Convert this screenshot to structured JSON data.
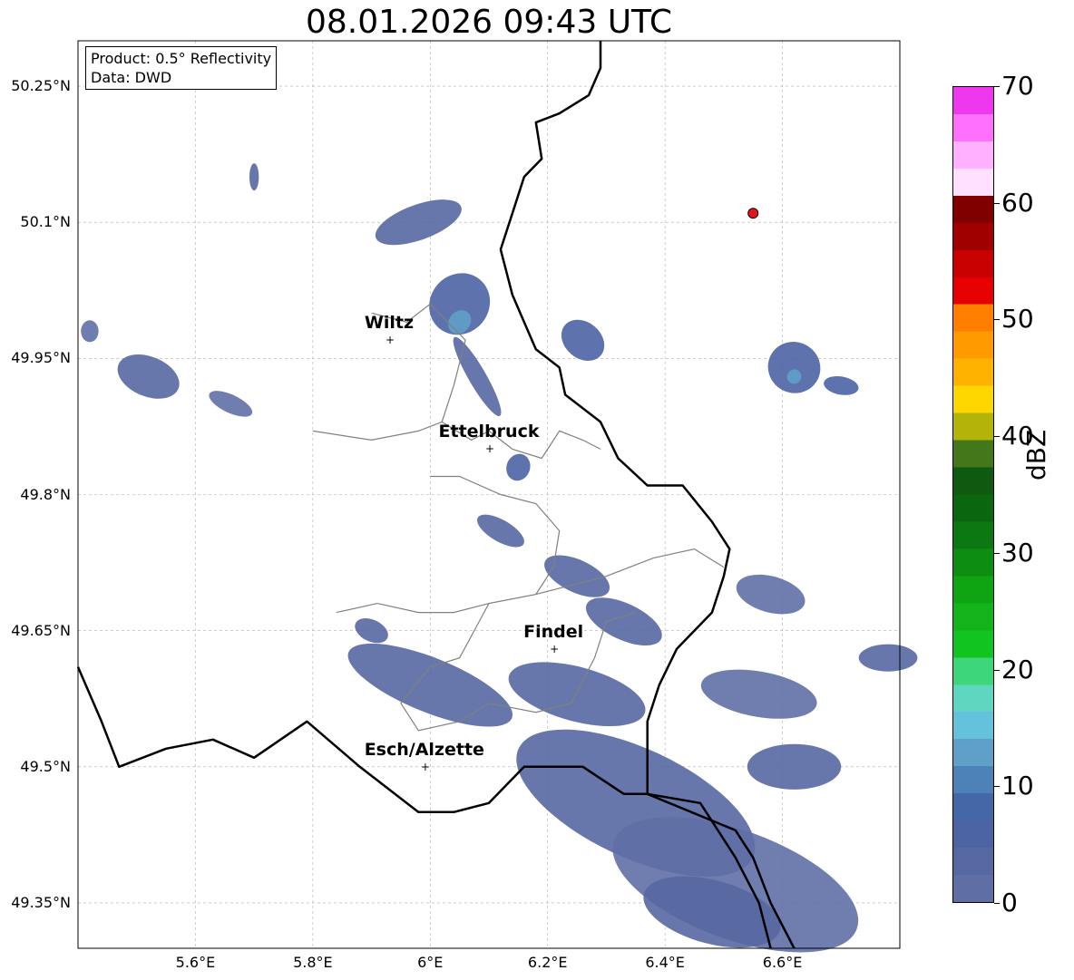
{
  "title": "08.01.2026 09:43 UTC",
  "info": {
    "product": "Product: 0.5° Reflectivity",
    "source": "Data: DWD"
  },
  "axes": {
    "y_ticks": [
      "50.25°N",
      "50.1°N",
      "49.95°N",
      "49.8°N",
      "49.65°N",
      "49.5°N",
      "49.35°N"
    ],
    "x_ticks": [
      "5.6°E",
      "5.8°E",
      "6°E",
      "6.2°E",
      "6.4°E",
      "6.6°E"
    ]
  },
  "extent": {
    "lon": [
      5.4,
      6.8
    ],
    "lat": [
      49.3,
      50.3
    ]
  },
  "cities": [
    {
      "name": "Wiltz",
      "lon": 5.93,
      "lat": 49.97
    },
    {
      "name": "Ettelbruck",
      "lon": 6.1,
      "lat": 49.85
    },
    {
      "name": "Findel",
      "lon": 6.21,
      "lat": 49.63
    },
    {
      "name": "Esch/Alzette",
      "lon": 5.99,
      "lat": 49.5
    }
  ],
  "radar_site": {
    "lon": 6.55,
    "lat": 50.11,
    "color": "#e8141c"
  },
  "colorbar": {
    "label": "dBZ",
    "ticks": [
      "0",
      "10",
      "20",
      "30",
      "40",
      "50",
      "60",
      "70"
    ],
    "min": 0,
    "max": 70,
    "step": 2.5,
    "colors": [
      "#5f6fa6",
      "#5668a2",
      "#4c63a4",
      "#4467a8",
      "#4d82b8",
      "#5fa0c8",
      "#64c2dc",
      "#5ed6c0",
      "#3ed67a",
      "#12c420",
      "#13b41a",
      "#0fa412",
      "#0e8e10",
      "#0c7812",
      "#0b6610",
      "#0d5a10",
      "#44761a",
      "#b2b408",
      "#ffd700",
      "#ffb300",
      "#ff9b00",
      "#ff7e00",
      "#e60000",
      "#c80000",
      "#a00000",
      "#800000",
      "#ffe0ff",
      "#ffb0ff",
      "#ff70ff",
      "#ee38ee"
    ]
  },
  "echoes": [
    {
      "lon": 5.52,
      "lat": 49.93,
      "rx": 0.055,
      "ry": 0.022,
      "rot": 22,
      "dbz": 3
    },
    {
      "lon": 5.42,
      "lat": 49.98,
      "rx": 0.015,
      "ry": 0.012,
      "rot": 0,
      "dbz": 2
    },
    {
      "lon": 5.66,
      "lat": 49.9,
      "rx": 0.04,
      "ry": 0.01,
      "rot": 25,
      "dbz": 2
    },
    {
      "lon": 5.7,
      "lat": 50.15,
      "rx": 0.008,
      "ry": 0.015,
      "rot": 0,
      "dbz": 3
    },
    {
      "lon": 5.98,
      "lat": 50.1,
      "rx": 0.03,
      "ry": 0.05,
      "rot": 70,
      "dbz": 4
    },
    {
      "lon": 6.05,
      "lat": 50.01,
      "rx": 0.05,
      "ry": 0.035,
      "rot": 40,
      "dbz": 7
    },
    {
      "lon": 6.05,
      "lat": 49.99,
      "rx": 0.018,
      "ry": 0.014,
      "rot": 40,
      "dbz": 14
    },
    {
      "lon": 6.08,
      "lat": 49.93,
      "rx": 0.015,
      "ry": 0.05,
      "rot": -30,
      "dbz": 3
    },
    {
      "lon": 6.15,
      "lat": 49.83,
      "rx": 0.02,
      "ry": 0.015,
      "rot": 20,
      "dbz": 5
    },
    {
      "lon": 6.26,
      "lat": 49.97,
      "rx": 0.04,
      "ry": 0.02,
      "rot": 40,
      "dbz": 5
    },
    {
      "lon": 6.62,
      "lat": 49.94,
      "rx": 0.045,
      "ry": 0.028,
      "rot": 30,
      "dbz": 6
    },
    {
      "lon": 6.62,
      "lat": 49.93,
      "rx": 0.012,
      "ry": 0.008,
      "rot": 30,
      "dbz": 14
    },
    {
      "lon": 6.7,
      "lat": 49.92,
      "rx": 0.03,
      "ry": 0.01,
      "rot": 10,
      "dbz": 7
    },
    {
      "lon": 6.12,
      "lat": 49.76,
      "rx": 0.045,
      "ry": 0.012,
      "rot": 30,
      "dbz": 3
    },
    {
      "lon": 6.25,
      "lat": 49.71,
      "rx": 0.06,
      "ry": 0.018,
      "rot": 25,
      "dbz": 4
    },
    {
      "lon": 6.33,
      "lat": 49.66,
      "rx": 0.07,
      "ry": 0.02,
      "rot": 25,
      "dbz": 3
    },
    {
      "lon": 6.58,
      "lat": 49.69,
      "rx": 0.06,
      "ry": 0.02,
      "rot": 15,
      "dbz": 2
    },
    {
      "lon": 5.9,
      "lat": 49.65,
      "rx": 0.03,
      "ry": 0.012,
      "rot": 25,
      "dbz": 3
    },
    {
      "lon": 6.0,
      "lat": 49.59,
      "rx": 0.15,
      "ry": 0.03,
      "rot": 22,
      "dbz": 3
    },
    {
      "lon": 6.25,
      "lat": 49.58,
      "rx": 0.12,
      "ry": 0.03,
      "rot": 15,
      "dbz": 3
    },
    {
      "lon": 6.56,
      "lat": 49.58,
      "rx": 0.1,
      "ry": 0.025,
      "rot": 10,
      "dbz": 2
    },
    {
      "lon": 6.78,
      "lat": 49.62,
      "rx": 0.05,
      "ry": 0.015,
      "rot": 0,
      "dbz": 3
    },
    {
      "lon": 6.62,
      "lat": 49.5,
      "rx": 0.08,
      "ry": 0.025,
      "rot": 0,
      "dbz": 3
    },
    {
      "lon": 6.35,
      "lat": 49.46,
      "rx": 0.22,
      "ry": 0.06,
      "rot": 25,
      "dbz": 3
    },
    {
      "lon": 6.52,
      "lat": 49.37,
      "rx": 0.22,
      "ry": 0.06,
      "rot": 20,
      "dbz": 2
    },
    {
      "lon": 6.48,
      "lat": 49.34,
      "rx": 0.12,
      "ry": 0.035,
      "rot": 15,
      "dbz": 4
    }
  ],
  "borders": {
    "national": [
      [
        [
          6.29,
          50.3
        ],
        [
          6.29,
          50.27
        ],
        [
          6.27,
          50.24
        ],
        [
          6.22,
          50.22
        ],
        [
          6.18,
          50.21
        ],
        [
          6.19,
          50.17
        ],
        [
          6.16,
          50.15
        ],
        [
          6.14,
          50.11
        ],
        [
          6.12,
          50.07
        ],
        [
          6.14,
          50.02
        ],
        [
          6.16,
          49.99
        ],
        [
          6.18,
          49.96
        ],
        [
          6.22,
          49.94
        ],
        [
          6.23,
          49.91
        ],
        [
          6.29,
          49.88
        ],
        [
          6.32,
          49.84
        ],
        [
          6.37,
          49.81
        ],
        [
          6.43,
          49.81
        ],
        [
          6.48,
          49.77
        ],
        [
          6.51,
          49.74
        ],
        [
          6.5,
          49.71
        ],
        [
          6.48,
          49.67
        ],
        [
          6.42,
          49.63
        ],
        [
          6.39,
          49.59
        ],
        [
          6.37,
          49.55
        ],
        [
          6.37,
          49.47
        ]
      ],
      [
        [
          5.4,
          49.61
        ],
        [
          5.44,
          49.55
        ],
        [
          5.47,
          49.5
        ],
        [
          5.55,
          49.52
        ],
        [
          5.63,
          49.53
        ],
        [
          5.7,
          49.51
        ],
        [
          5.79,
          49.55
        ],
        [
          5.88,
          49.5
        ],
        [
          5.98,
          49.45
        ],
        [
          6.04,
          49.45
        ],
        [
          6.1,
          49.46
        ],
        [
          6.16,
          49.5
        ],
        [
          6.26,
          49.5
        ],
        [
          6.33,
          49.47
        ],
        [
          6.37,
          49.47
        ],
        [
          6.46,
          49.46
        ],
        [
          6.52,
          49.4
        ],
        [
          6.56,
          49.35
        ],
        [
          6.58,
          49.3
        ]
      ],
      [
        [
          6.37,
          49.47
        ],
        [
          6.52,
          49.43
        ],
        [
          6.55,
          49.4
        ],
        [
          6.58,
          49.35
        ],
        [
          6.62,
          49.3
        ]
      ]
    ],
    "regional": [
      [
        [
          5.9,
          50.0
        ],
        [
          5.96,
          49.99
        ],
        [
          6.0,
          50.01
        ],
        [
          6.06,
          49.97
        ],
        [
          6.04,
          49.92
        ],
        [
          6.02,
          49.88
        ],
        [
          6.07,
          49.86
        ],
        [
          6.1,
          49.87
        ],
        [
          6.14,
          49.85
        ],
        [
          6.19,
          49.84
        ],
        [
          6.22,
          49.87
        ],
        [
          6.26,
          49.86
        ],
        [
          6.29,
          49.85
        ]
      ],
      [
        [
          5.8,
          49.87
        ],
        [
          5.9,
          49.86
        ],
        [
          5.98,
          49.87
        ],
        [
          6.02,
          49.88
        ]
      ],
      [
        [
          6.0,
          49.82
        ],
        [
          6.05,
          49.82
        ],
        [
          6.12,
          49.8
        ],
        [
          6.18,
          49.79
        ],
        [
          6.22,
          49.76
        ],
        [
          6.21,
          49.72
        ],
        [
          6.18,
          49.69
        ],
        [
          6.1,
          49.68
        ],
        [
          6.04,
          49.67
        ],
        [
          5.98,
          49.67
        ],
        [
          5.91,
          49.68
        ],
        [
          5.84,
          49.67
        ]
      ],
      [
        [
          6.18,
          49.69
        ],
        [
          6.24,
          49.7
        ],
        [
          6.3,
          49.71
        ],
        [
          6.38,
          49.73
        ],
        [
          6.45,
          49.74
        ],
        [
          6.5,
          49.72
        ]
      ],
      [
        [
          6.1,
          49.68
        ],
        [
          6.05,
          49.62
        ],
        [
          6.0,
          49.61
        ],
        [
          5.95,
          49.57
        ],
        [
          5.98,
          49.54
        ],
        [
          6.05,
          49.55
        ],
        [
          6.1,
          49.57
        ],
        [
          6.18,
          49.56
        ],
        [
          6.24,
          49.57
        ],
        [
          6.28,
          49.62
        ],
        [
          6.3,
          49.66
        ],
        [
          6.35,
          49.67
        ]
      ]
    ]
  }
}
